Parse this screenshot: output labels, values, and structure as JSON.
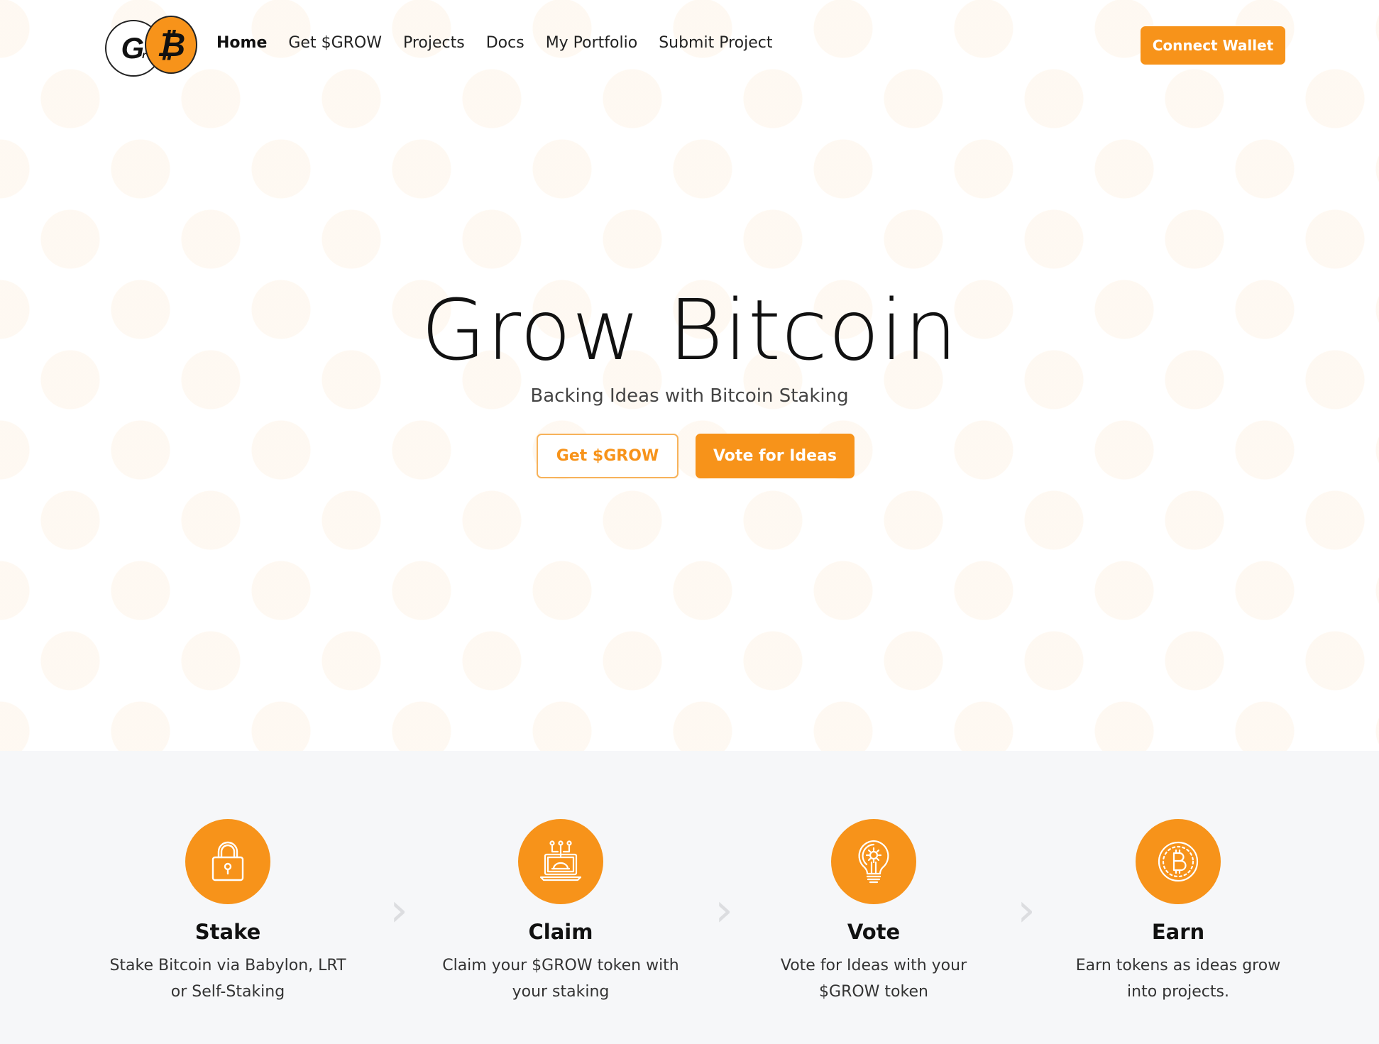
{
  "nav": {
    "logo_text_g": "G",
    "logo_text_sub": "r",
    "logo_text_b": "₿",
    "links": [
      {
        "label": "Home",
        "active": true
      },
      {
        "label": "Get $GROW",
        "active": false
      },
      {
        "label": "Projects",
        "active": false
      },
      {
        "label": "Docs",
        "active": false
      },
      {
        "label": "My Portfolio",
        "active": false
      },
      {
        "label": "Submit Project",
        "active": false
      }
    ],
    "connect_label": "Connect Wallet"
  },
  "hero": {
    "title": "Grow Bitcoin",
    "subtitle": "Backing Ideas with Bitcoin Staking",
    "primary_cta": "Get $GROW",
    "secondary_cta": "Vote for Ideas",
    "background_pattern_icon": "bitcoin-icon"
  },
  "steps": [
    {
      "icon": "lock-icon",
      "title": "Stake",
      "desc_line1": "Stake Bitcoin via Babylon, LRT",
      "desc_line2": "or Self-Staking"
    },
    {
      "icon": "laptop-claim-icon",
      "title": "Claim",
      "desc_line1": "Claim your $GROW token with",
      "desc_line2": "your staking"
    },
    {
      "icon": "lightbulb-icon",
      "title": "Vote",
      "desc_line1": "Vote for Ideas with your",
      "desc_line2": "$GROW token"
    },
    {
      "icon": "bitcoin-coin-icon",
      "title": "Earn",
      "desc_line1": "Earn tokens as ideas grow",
      "desc_line2": "into projects."
    }
  ],
  "colors": {
    "accent": "#f7931a",
    "steps_background": "#f6f7f9"
  }
}
